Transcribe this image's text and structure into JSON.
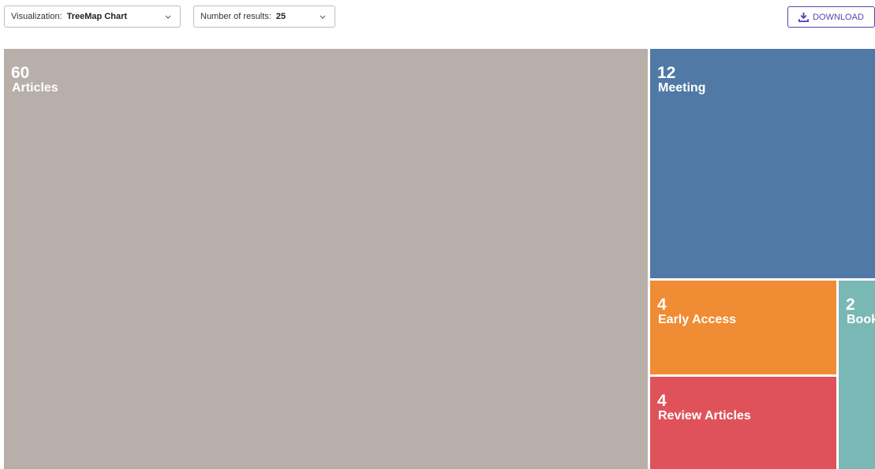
{
  "toolbar": {
    "visualization_label": "Visualization:",
    "visualization_value": "TreeMap Chart",
    "results_label": "Number of results:",
    "results_value": "25",
    "download_label": "DOWNLOAD"
  },
  "colors": {
    "articles": "#b8afaa",
    "meeting": "#5079a6",
    "early_access": "#f08c33",
    "review_articles": "#e0525a",
    "book": "#7ab8b5",
    "accent": "#5b3fb5"
  },
  "chart_data": {
    "type": "treemap",
    "items": [
      {
        "name": "Articles",
        "value": 60,
        "count_label": "60"
      },
      {
        "name": "Meeting",
        "value": 12,
        "count_label": "12"
      },
      {
        "name": "Early Access",
        "value": 4,
        "count_label": "4"
      },
      {
        "name": "Review Articles",
        "value": 4,
        "count_label": "4"
      },
      {
        "name": "Book",
        "value": 2,
        "count_label": "2"
      }
    ]
  }
}
